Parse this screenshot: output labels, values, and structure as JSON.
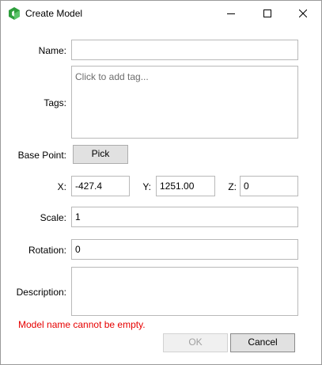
{
  "window": {
    "title": "Create Model",
    "app_icon": "cube-app-icon"
  },
  "form": {
    "name": {
      "label": "Name:",
      "value": ""
    },
    "tags": {
      "label": "Tags:",
      "placeholder": "Click to add tag..."
    },
    "base_point": {
      "label": "Base Point:",
      "pick_label": "Pick"
    },
    "x": {
      "label": "X:",
      "value": "-427.4"
    },
    "y": {
      "label": "Y:",
      "value": "1251.00"
    },
    "z": {
      "label": "Z:",
      "value": "0"
    },
    "scale": {
      "label": "Scale:",
      "value": "1"
    },
    "rotation": {
      "label": "Rotation:",
      "value": "0"
    },
    "description": {
      "label": "Description:",
      "value": ""
    }
  },
  "error": {
    "message": "Model name cannot be empty.",
    "color": "#e60000"
  },
  "buttons": {
    "ok": "OK",
    "ok_enabled": false,
    "cancel": "Cancel"
  }
}
